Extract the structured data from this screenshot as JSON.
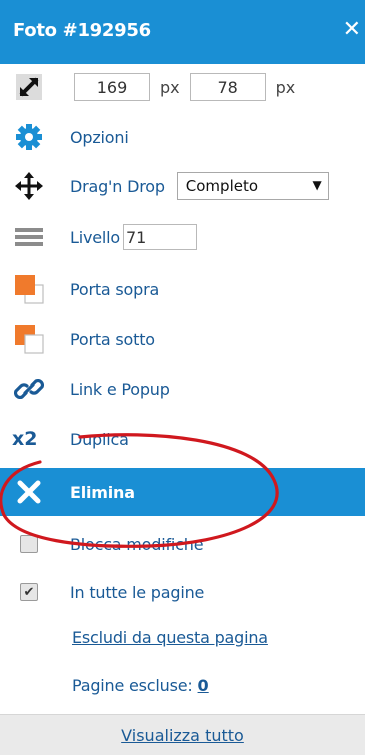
{
  "header": {
    "title": "Foto #192956",
    "close_glyph": "✕",
    "bg": "#1a8fd4"
  },
  "size": {
    "width": "169",
    "height": "78",
    "unit": "px"
  },
  "menu": {
    "options": "Opzioni",
    "dragdrop": "Drag'n Drop",
    "dragdrop_value": "Completo",
    "level": "Livello",
    "level_value": "71",
    "bring_front": "Porta sopra",
    "send_back": "Porta sotto",
    "link_popup": "Link e Popup",
    "duplicate_icon_text": "x2",
    "duplicate": "Duplica",
    "delete": "Elimina",
    "lock": "Blocca modifiche",
    "all_pages": "In tutte le pagine",
    "exclude": "Escludi da questa pagina",
    "excluded_label": "Pagine escluse:",
    "excluded_count": "0"
  },
  "footer": {
    "show_all": "Visualizza tutto"
  },
  "colors": {
    "accent": "#1a8fd4",
    "text": "#1a5a96",
    "orange": "#f07a2c",
    "annotation": "#d0181e"
  }
}
